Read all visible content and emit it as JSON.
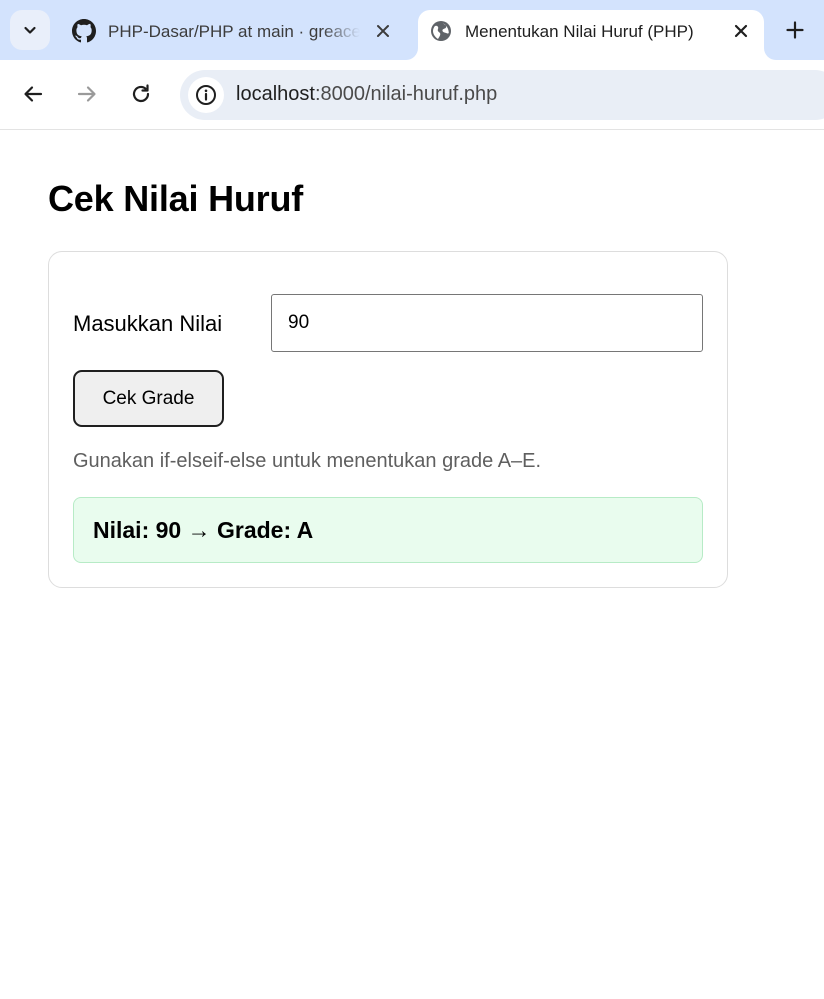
{
  "browser": {
    "tabs": [
      {
        "title": "PHP-Dasar/PHP at main · greacee",
        "favicon": "github-icon",
        "active": false
      },
      {
        "title": "Menentukan Nilai Huruf (PHP)",
        "favicon": "globe-icon",
        "active": true
      }
    ],
    "address_bar": {
      "host": "localhost",
      "path": ":8000/nilai-huruf.php"
    }
  },
  "page": {
    "title": "Cek Nilai Huruf",
    "form": {
      "label": "Masukkan Nilai",
      "input_value": "90",
      "submit_label": "Cek Grade",
      "hint": "Gunakan if-elseif-else untuk menentukan grade A–E."
    },
    "result": {
      "text": "Nilai: 90 → Grade: A"
    }
  },
  "colors": {
    "tabstrip": "#d3e3fd",
    "omnibox": "#e9eef6",
    "result_bg": "#e9fcee",
    "result_border": "#b7ebc6"
  }
}
